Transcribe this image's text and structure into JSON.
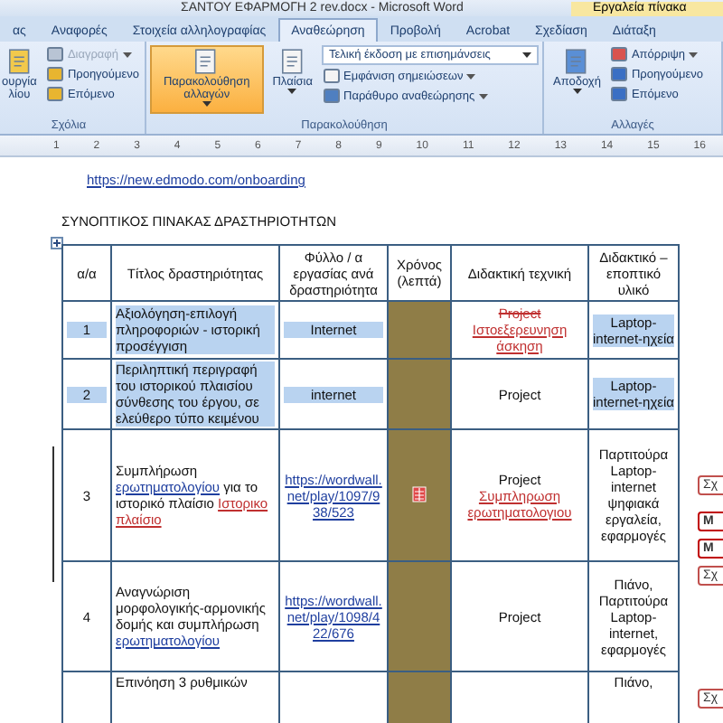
{
  "window": {
    "title": "ΣΑΝΤΟΥ ΕΦΑΡΜΟΓΗ 2 rev.docx - Microsoft Word",
    "context_tab": "Εργαλεία πίνακα"
  },
  "tabs": [
    {
      "label": "ας",
      "selected": false
    },
    {
      "label": "Αναφορές",
      "selected": false
    },
    {
      "label": "Στοιχεία αλληλογραφίας",
      "selected": false
    },
    {
      "label": "Αναθεώρηση",
      "selected": true
    },
    {
      "label": "Προβολή",
      "selected": false
    },
    {
      "label": "Acrobat",
      "selected": false
    },
    {
      "label": "Σχεδίαση",
      "selected": false
    },
    {
      "label": "Διάταξη",
      "selected": false
    }
  ],
  "ribbon": {
    "groups": [
      {
        "label": "Σχόλια",
        "big": [
          {
            "label": "ουργία λίου",
            "kind": "comment",
            "active": false,
            "caret": false
          }
        ],
        "small": [
          {
            "label": "Διαγραφή",
            "kind": "delete",
            "disabled": true,
            "caret": true
          },
          {
            "label": "Προηγούμενο",
            "kind": "prev",
            "disabled": false,
            "caret": false
          },
          {
            "label": "Επόμενο",
            "kind": "next",
            "disabled": false,
            "caret": false
          }
        ]
      },
      {
        "label": "Παρακολούθηση",
        "big": [
          {
            "label": "Παρακολούθηση αλλαγών",
            "kind": "track",
            "active": true,
            "caret": true
          },
          {
            "label": "Πλαίσια",
            "kind": "balloons",
            "active": false,
            "caret": true
          }
        ],
        "dropdown": "Τελική έκδοση με επισημάνσεις",
        "small": [
          {
            "label": "Εμφάνιση σημειώσεων",
            "kind": "show",
            "disabled": false,
            "caret": true
          },
          {
            "label": "Παράθυρο αναθεώρησης",
            "kind": "pane",
            "disabled": false,
            "caret": true
          }
        ]
      },
      {
        "label": "Αλλαγές",
        "big": [
          {
            "label": "Αποδοχή",
            "kind": "accept",
            "active": false,
            "caret": true
          }
        ],
        "small": [
          {
            "label": "Απόρριψη",
            "kind": "reject",
            "disabled": false,
            "caret": true
          },
          {
            "label": "Προηγούμενο",
            "kind": "prevchange",
            "disabled": false,
            "caret": false
          },
          {
            "label": "Επόμενο",
            "kind": "nextchange",
            "disabled": false,
            "caret": false
          }
        ]
      }
    ]
  },
  "ruler": [
    "1",
    "2",
    "3",
    "4",
    "5",
    "6",
    "7",
    "8",
    "9",
    "10",
    "11",
    "12",
    "13",
    "14",
    "15",
    "16"
  ],
  "document": {
    "link": "https://new.edmodo.com/onboarding",
    "heading": "ΣΥΝΟΠΤΙΚΟΣ ΠΙΝΑΚΑΣ ΔΡΑΣΤΗΡΙΟΤΗΤΩΝ",
    "table": {
      "columns": [
        "α/α",
        "Τίτλος δραστηριότητας",
        "Φύλλο / α εργασίας ανά δραστηριότητα",
        "Χρόνος (λεπτά)",
        "Διδακτική τεχνική",
        "Διδακτικό – εποπτικό υλικό"
      ],
      "rows": [
        {
          "number": "1",
          "selected": true,
          "comment_anchor": false,
          "title": [
            {
              "text": "Αξιολόγηση-επιλογή πληροφοριών - ιστορική προσέγγιση",
              "kind": "plain"
            }
          ],
          "sheet": [
            {
              "text": "Internet",
              "kind": "plain"
            }
          ],
          "technique": [
            {
              "text": "Project",
              "kind": "deleted"
            },
            {
              "text": "Ιστοεξερευνηση άσκηση",
              "kind": "inserted"
            }
          ],
          "material": "Laptop-internet-ηχεία"
        },
        {
          "number": "2",
          "selected": true,
          "comment_anchor": false,
          "title": [
            {
              "text": "Περιληπτική περιγραφή του ιστορικού πλαισίου σύνθεσης του έργου, σε ελεύθερο τύπο κειμένου",
              "kind": "plain"
            }
          ],
          "sheet": [
            {
              "text": "internet",
              "kind": "plain"
            }
          ],
          "technique": [
            {
              "text": "Project",
              "kind": "plain"
            }
          ],
          "material": "Laptop-internet-ηχεία"
        },
        {
          "number": "3",
          "selected": false,
          "comment_anchor": true,
          "title": [
            {
              "text": "Συμπλήρωση ",
              "kind": "plain"
            },
            {
              "text": "ερωτηματολογίου",
              "kind": "link"
            },
            {
              "text": " για το ιστορικό πλαίσιο ",
              "kind": "plain"
            },
            {
              "text": "Ιστορικο πλαίσιο",
              "kind": "inserted"
            }
          ],
          "sheet": [
            {
              "text": "https://wordwall.net/play/1097/938/523",
              "kind": "link"
            }
          ],
          "technique": [
            {
              "text": "Project ",
              "kind": "plain"
            },
            {
              "text": "Συμπληρωση ερωτηματολογιου",
              "kind": "inserted"
            }
          ],
          "material": "Παρτιτούρα Laptop-internet ψηφιακά εργαλεία, εφαρμογές"
        },
        {
          "number": "4",
          "selected": false,
          "comment_anchor": false,
          "title": [
            {
              "text": "Αναγνώριση μορφολογικής-αρμονικής δομής και συμπλήρωση ",
              "kind": "plain"
            },
            {
              "text": "ερωτηματολογίου",
              "kind": "link"
            }
          ],
          "sheet": [
            {
              "text": "https://wordwall.net/play/1098/422/676",
              "kind": "link"
            }
          ],
          "technique": [
            {
              "text": "Project",
              "kind": "plain"
            }
          ],
          "material": "Πιάνο, Παρτιτούρα Laptop-internet, εφαρμογές"
        },
        {
          "number": "",
          "selected": false,
          "comment_anchor": false,
          "title": [
            {
              "text": "Επινόηση 3 ρυθμικών",
              "kind": "plain"
            }
          ],
          "sheet": [],
          "technique": [],
          "material": "Πιάνο,"
        }
      ]
    }
  },
  "balloons": [
    {
      "label": "Σχ",
      "kind": "comment"
    },
    {
      "label": "Μ",
      "kind": "change"
    },
    {
      "label": "Μ",
      "kind": "change"
    },
    {
      "label": "Σχ",
      "kind": "comment"
    },
    {
      "label": "Σχ",
      "kind": "comment"
    }
  ]
}
